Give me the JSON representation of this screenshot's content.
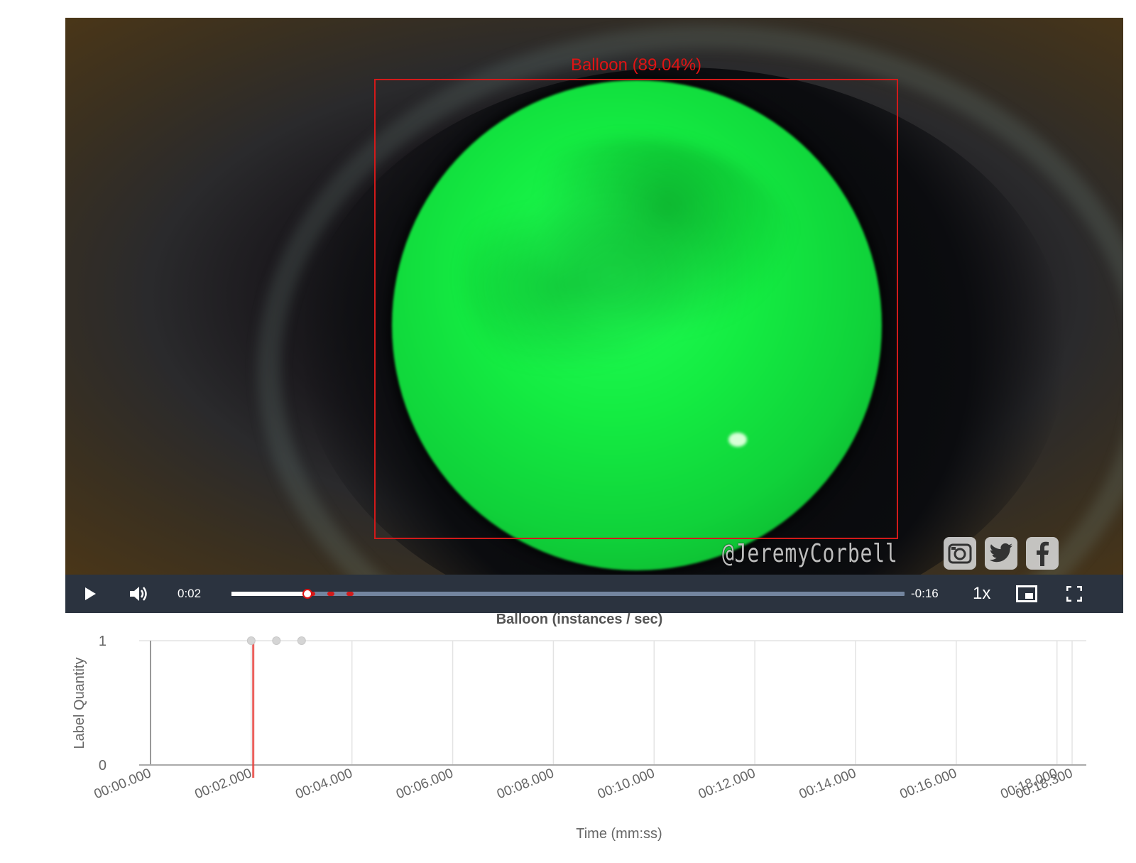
{
  "video": {
    "detection": {
      "label": "Balloon (89.04%)"
    },
    "watermark": "@JeremyCorbell",
    "social_icons": [
      "instagram-icon",
      "twitter-icon",
      "facebook-icon"
    ],
    "controls": {
      "current_time": "0:02",
      "remaining_time": "-0:16",
      "playback_rate": "1x",
      "progress": 0.113,
      "markers": [
        0.114,
        0.142,
        0.171
      ]
    }
  },
  "colors": {
    "bbox": "#d21a1a",
    "control_bar": "#2b333f",
    "progress_track": "#73859f",
    "chart_series": "#e8443f"
  },
  "chart_data": {
    "type": "line",
    "title": "Balloon (instances / sec)",
    "xlabel": "Time (mm:ss)",
    "ylabel": "Label Quantity",
    "xlim": [
      0,
      18.3
    ],
    "ylim": [
      0,
      1
    ],
    "x_ticks": [
      "00:00.000",
      "00:02.000",
      "00:04.000",
      "00:06.000",
      "00:08.000",
      "00:10.000",
      "00:12.000",
      "00:14.000",
      "00:16.000",
      "00:18.000",
      "00:18.300"
    ],
    "x_tick_values": [
      0,
      2,
      4,
      6,
      8,
      10,
      12,
      14,
      16,
      18,
      18.3
    ],
    "y_ticks": [
      "0",
      "1"
    ],
    "grid": true,
    "series": [
      {
        "color": "#e8443f",
        "points": [
          [
            2.04,
            0
          ],
          [
            2.04,
            1
          ]
        ]
      }
    ],
    "markers": [
      {
        "x": 2.0,
        "y": 1
      },
      {
        "x": 2.5,
        "y": 1
      },
      {
        "x": 3.0,
        "y": 1
      }
    ]
  }
}
